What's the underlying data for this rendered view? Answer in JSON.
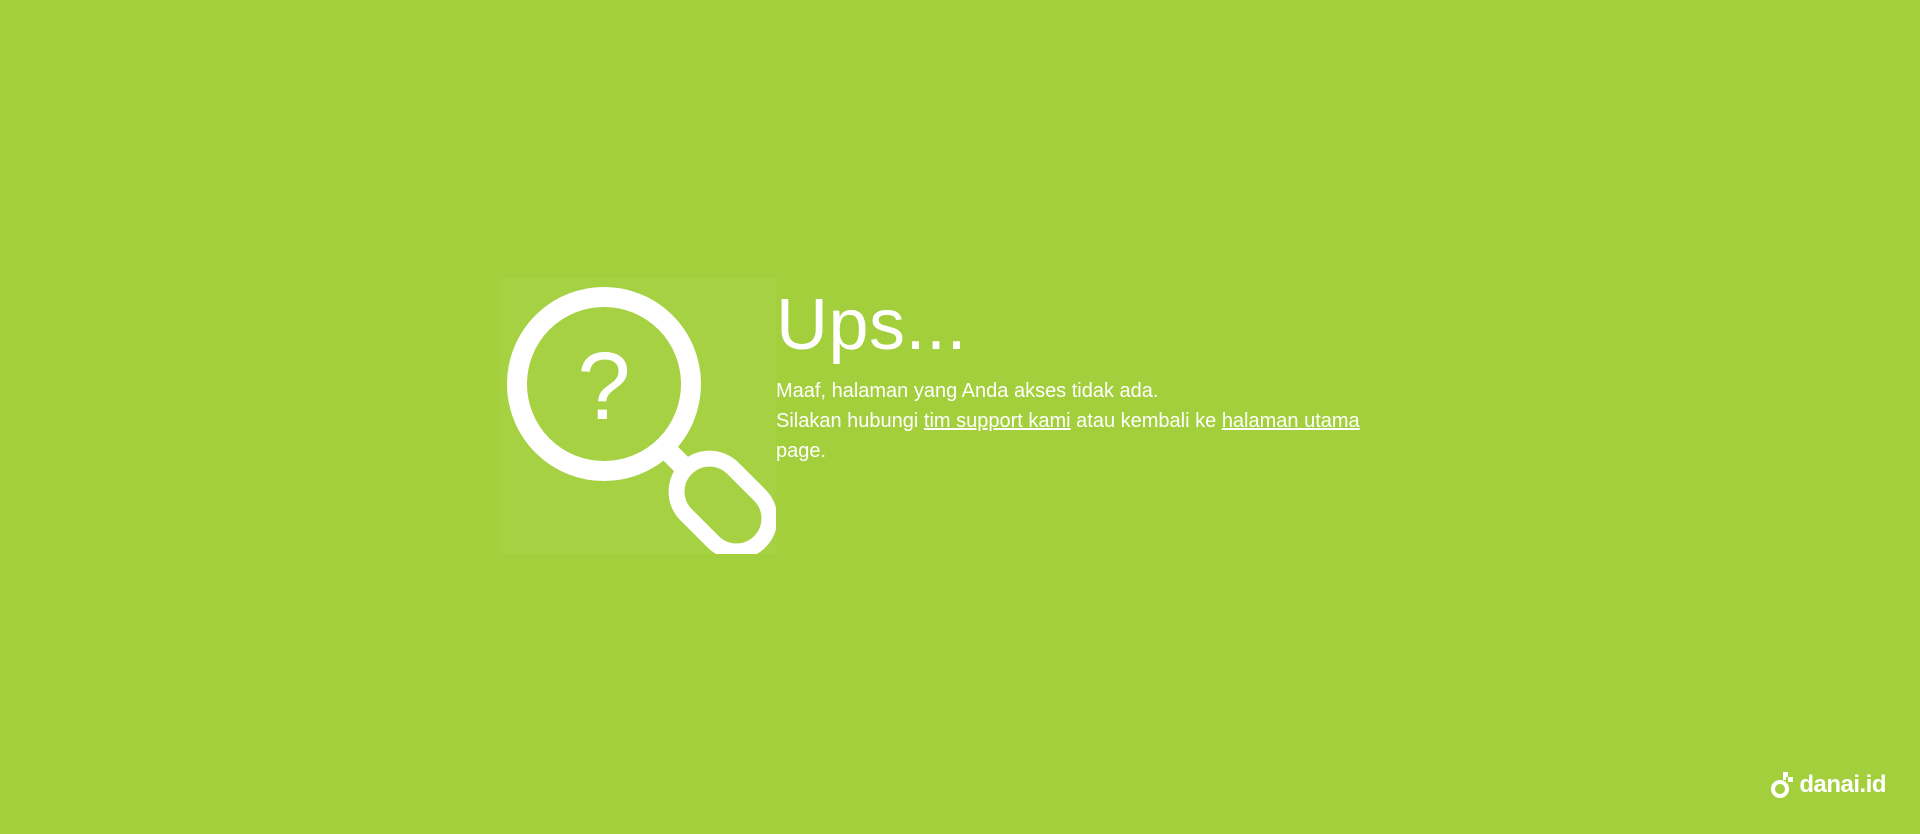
{
  "colors": {
    "background": "#a2cf3b",
    "foreground": "#ffffff"
  },
  "illustration": {
    "icon": "magnifier-question-icon",
    "glyph": "?"
  },
  "error": {
    "heading": "Ups...",
    "line1": "Maaf, halaman yang Anda akses tidak ada.",
    "line2_prefix": "Silakan hubungi ",
    "support_link": "tim support kami",
    "line2_middle": " atau kembali ke ",
    "home_link": "halaman utama",
    "line3": "page."
  },
  "brand": {
    "name": "danai.id",
    "icon": "danai-logo-icon"
  }
}
